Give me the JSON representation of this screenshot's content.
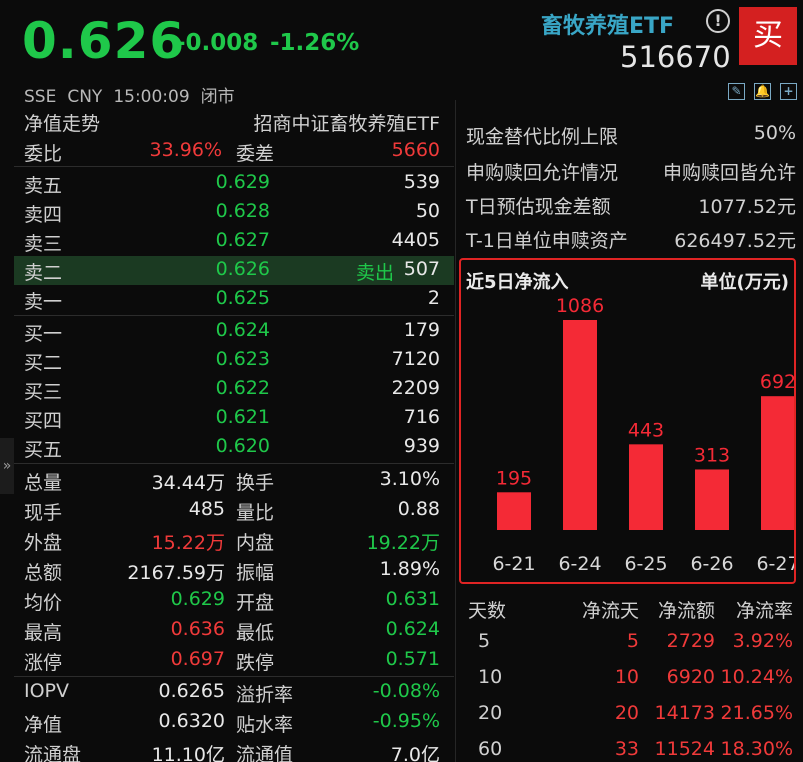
{
  "header": {
    "price": "0.626",
    "change": "-0.008",
    "change_pct": "-1.26%",
    "market": "SSE",
    "currency": "CNY",
    "time": "15:00:09",
    "status": "闭市",
    "name": "畜牧养殖ETF",
    "code": "516670",
    "buy_label": "买",
    "info_icon": "!",
    "tools": [
      {
        "icon": "edit-icon",
        "glyph": "✎"
      },
      {
        "icon": "bell-icon",
        "glyph": "🔔"
      },
      {
        "icon": "add-icon",
        "glyph": "+"
      }
    ]
  },
  "book": {
    "nav_trend": "净值走势",
    "fund_full_name": "招商中证畜牧养殖ETF",
    "wei_bi_label": "委比",
    "wei_bi": "33.96%",
    "wei_cha_label": "委差",
    "wei_cha": "5660",
    "asks": [
      {
        "label": "卖五",
        "price": "0.629",
        "vol": "539",
        "tag": ""
      },
      {
        "label": "卖四",
        "price": "0.628",
        "vol": "50",
        "tag": ""
      },
      {
        "label": "卖三",
        "price": "0.627",
        "vol": "4405",
        "tag": ""
      },
      {
        "label": "卖二",
        "price": "0.626",
        "vol": "507",
        "tag": "卖出"
      },
      {
        "label": "卖一",
        "price": "0.625",
        "vol": "2",
        "tag": ""
      }
    ],
    "bids": [
      {
        "label": "买一",
        "price": "0.624",
        "vol": "179"
      },
      {
        "label": "买二",
        "price": "0.623",
        "vol": "7120"
      },
      {
        "label": "买三",
        "price": "0.622",
        "vol": "2209"
      },
      {
        "label": "买四",
        "price": "0.621",
        "vol": "716"
      },
      {
        "label": "买五",
        "price": "0.620",
        "vol": "939"
      }
    ]
  },
  "stats": [
    {
      "l1": "总量",
      "v1": "34.44万",
      "c1": "w",
      "l2": "换手",
      "v2": "3.10%",
      "c2": "w"
    },
    {
      "l1": "现手",
      "v1": "485",
      "c1": "w",
      "l2": "量比",
      "v2": "0.88",
      "c2": "w"
    },
    {
      "l1": "外盘",
      "v1": "15.22万",
      "c1": "r",
      "l2": "内盘",
      "v2": "19.22万",
      "c2": "g"
    },
    {
      "l1": "总额",
      "v1": "2167.59万",
      "c1": "w",
      "l2": "振幅",
      "v2": "1.89%",
      "c2": "w"
    },
    {
      "l1": "均价",
      "v1": "0.629",
      "c1": "g",
      "l2": "开盘",
      "v2": "0.631",
      "c2": "g"
    },
    {
      "l1": "最高",
      "v1": "0.636",
      "c1": "r",
      "l2": "最低",
      "v2": "0.624",
      "c2": "g"
    },
    {
      "l1": "涨停",
      "v1": "0.697",
      "c1": "r",
      "l2": "跌停",
      "v2": "0.571",
      "c2": "g"
    },
    {
      "l1": "IOPV",
      "v1": "0.6265",
      "c1": "w",
      "l2": "溢折率",
      "v2": "-0.08%",
      "c2": "g"
    },
    {
      "l1": "净值",
      "v1": "0.6320",
      "c1": "w",
      "l2": "贴水率",
      "v2": "-0.95%",
      "c2": "g"
    },
    {
      "l1": "流通盘",
      "v1": "11.10亿",
      "c1": "w",
      "l2": "流通值",
      "v2": "7.0亿",
      "c2": "w"
    }
  ],
  "fund_info": [
    {
      "label": "现金替代比例上限",
      "value": "50%"
    },
    {
      "label": "申购赎回允许情况",
      "value": "申购赎回皆允许"
    },
    {
      "label": "T日预估现金差额",
      "value": "1077.52元"
    },
    {
      "label": "T-1日单位申赎资产",
      "value": "626497.52元"
    }
  ],
  "chart_data": {
    "type": "bar",
    "title": "近5日净流入",
    "unit": "单位(万元)",
    "categories": [
      "6-21",
      "6-24",
      "6-25",
      "6-26",
      "6-27"
    ],
    "values": [
      195,
      1086,
      443,
      313,
      692
    ],
    "bar_color": "#f42a36",
    "label_color": "#f42a36"
  },
  "flow_table": {
    "headers": [
      "天数",
      "净流天",
      "净流额",
      "净流率"
    ],
    "rows": [
      [
        "5",
        "5",
        "2729",
        "3.92%"
      ],
      [
        "10",
        "10",
        "6920",
        "10.24%"
      ],
      [
        "20",
        "20",
        "14173",
        "21.65%"
      ],
      [
        "60",
        "33",
        "11524",
        "18.30%"
      ]
    ]
  },
  "colors": {
    "up": "#f03a3a",
    "down": "#1fc84a",
    "accent": "#39a6c6",
    "highlight_box": "#e02424"
  }
}
